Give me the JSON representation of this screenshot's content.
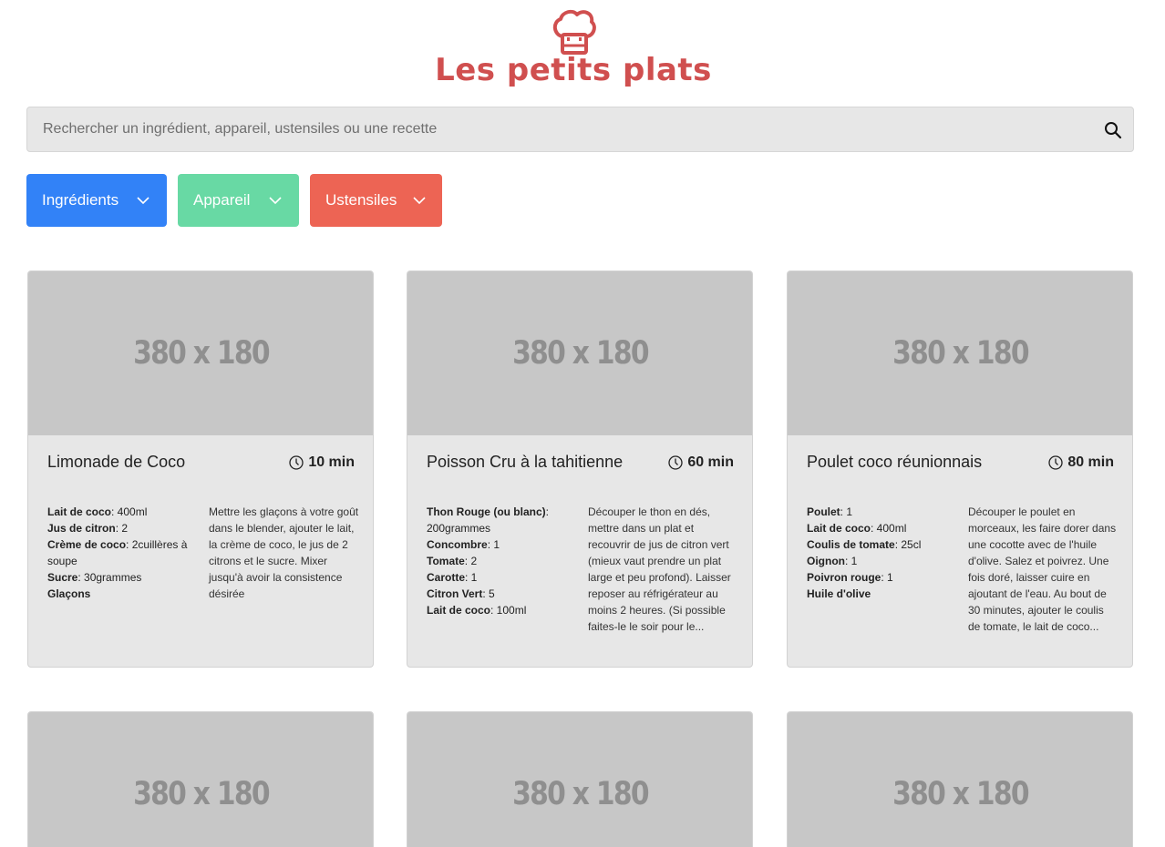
{
  "header": {
    "logo_icon": "chef-hat-icon",
    "title": "Les petits plats",
    "brand_color": "#d04f4f"
  },
  "search": {
    "placeholder": "Rechercher un ingrédient, appareil, ustensiles ou une recette",
    "value": "",
    "icon": "search-icon"
  },
  "filters": [
    {
      "label": "Ingrédients",
      "color": "#3282f7",
      "icon": "chevron-down-icon"
    },
    {
      "label": "Appareil",
      "color": "#68d9a4",
      "icon": "chevron-down-icon"
    },
    {
      "label": "Ustensiles",
      "color": "#ed6454",
      "icon": "chevron-down-icon"
    }
  ],
  "recipes": [
    {
      "image_text": "380 x 180",
      "title": "Limonade de Coco",
      "time": "10 min",
      "ingredients": [
        {
          "name": "Lait de coco",
          "qty": ": 400ml"
        },
        {
          "name": "Jus de citron",
          "qty": ": 2"
        },
        {
          "name": "Crème de coco",
          "qty": ": 2cuillères à soupe"
        },
        {
          "name": "Sucre",
          "qty": ": 30grammes"
        },
        {
          "name": "Glaçons",
          "qty": ""
        }
      ],
      "description": "Mettre les glaçons à votre goût dans le blender, ajouter le lait, la crème de coco, le jus de 2 citrons et le sucre. Mixer jusqu'à avoir la consistence désirée"
    },
    {
      "image_text": "380 x 180",
      "title": "Poisson Cru à la tahitienne",
      "time": "60 min",
      "ingredients": [
        {
          "name": "Thon Rouge (ou blanc)",
          "qty": ": 200grammes"
        },
        {
          "name": "Concombre",
          "qty": ": 1"
        },
        {
          "name": "Tomate",
          "qty": ": 2"
        },
        {
          "name": "Carotte",
          "qty": ": 1"
        },
        {
          "name": "Citron Vert",
          "qty": ": 5"
        },
        {
          "name": "Lait de coco",
          "qty": ": 100ml"
        }
      ],
      "description": "Découper le thon en dés, mettre dans un plat et recouvrir de jus de citron vert (mieux vaut prendre un plat large et peu profond). Laisser reposer au réfrigérateur au moins 2 heures. (Si possible faites-le le soir pour le..."
    },
    {
      "image_text": "380 x 180",
      "title": "Poulet coco réunionnais",
      "time": "80 min",
      "ingredients": [
        {
          "name": "Poulet",
          "qty": ": 1"
        },
        {
          "name": "Lait de coco",
          "qty": ": 400ml"
        },
        {
          "name": "Coulis de tomate",
          "qty": ": 25cl"
        },
        {
          "name": "Oignon",
          "qty": ": 1"
        },
        {
          "name": "Poivron rouge",
          "qty": ": 1"
        },
        {
          "name": "Huile d'olive",
          "qty": ""
        }
      ],
      "description": "Découper le poulet en morceaux, les faire dorer dans une cocotte avec de l'huile d'olive. Salez et poivrez. Une fois doré, laisser cuire en ajoutant de l'eau. Au bout de 30 minutes, ajouter le coulis de tomate, le lait de coco..."
    },
    {
      "image_text": "380 x 180"
    },
    {
      "image_text": "380 x 180"
    },
    {
      "image_text": "380 x 180"
    }
  ]
}
